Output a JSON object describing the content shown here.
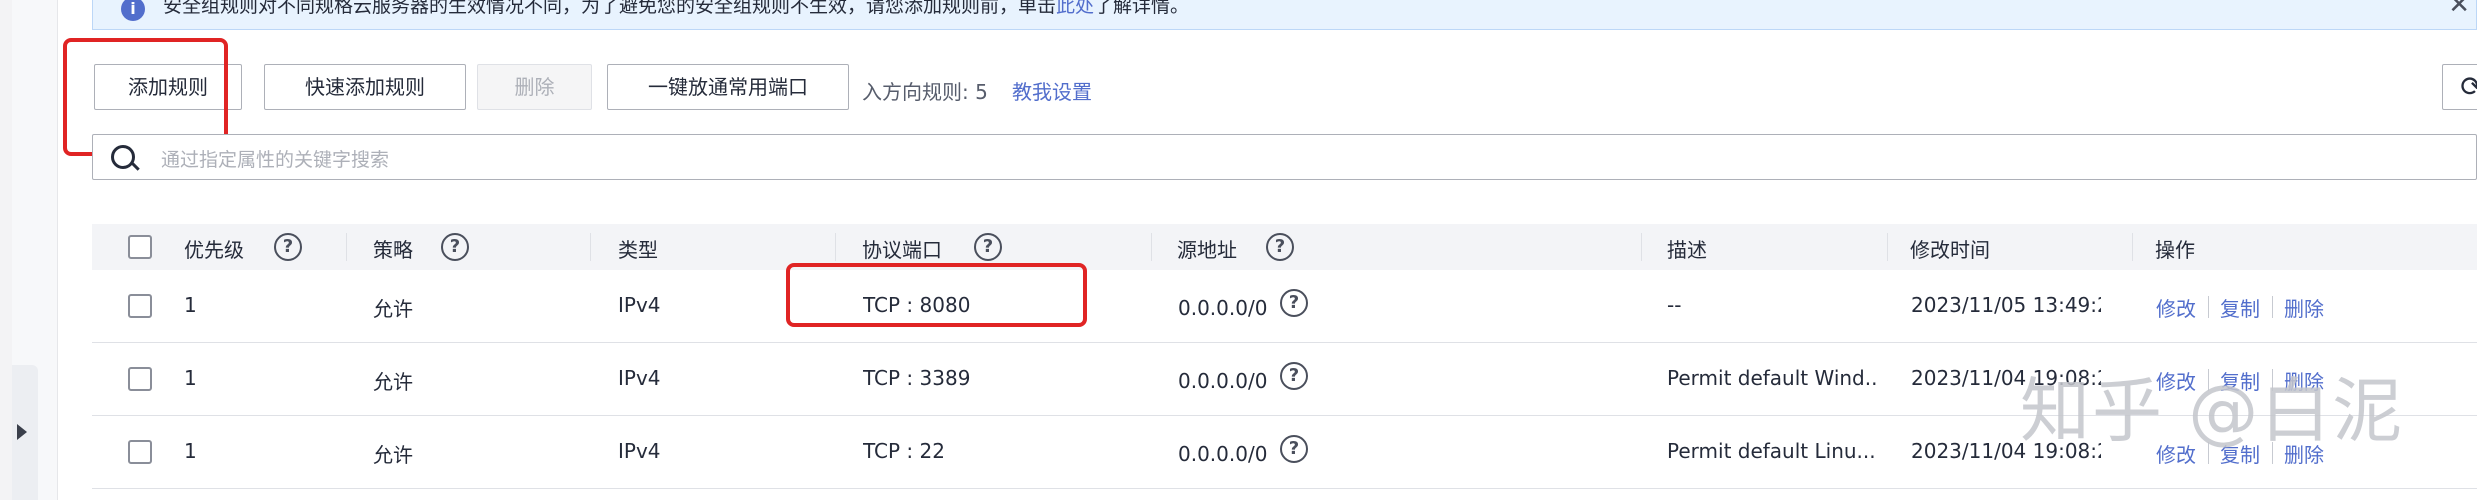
{
  "notice": {
    "text_before_link": "安全组规则对不同规格云服务器的生效情况不同，为了避免您的安全组规则不生效，请您添加规则前，单击",
    "link_text": "此处",
    "text_after_link": "了解详情。"
  },
  "toolbar": {
    "add_rule": "添加规则",
    "quick_add_rule": "快速添加规则",
    "delete": "删除",
    "one_click_open_ports": "一键放通常用端口",
    "inbound_rules_label": "入方向规则: 5",
    "teach_me_link": "教我设置"
  },
  "search": {
    "placeholder": "通过指定属性的关键字搜索"
  },
  "table": {
    "headers": {
      "priority": "优先级",
      "policy": "策略",
      "type": "类型",
      "protocol_port": "协议端口",
      "source": "源地址",
      "description": "描述",
      "modified_time": "修改时间",
      "actions": "操作"
    },
    "rows": [
      {
        "priority": "1",
        "policy": "允许",
        "type": "IPv4",
        "protocol_port": "TCP : 8080",
        "source": "0.0.0.0/0",
        "description": "--",
        "modified_time": "2023/11/05 13:49:2..."
      },
      {
        "priority": "1",
        "policy": "允许",
        "type": "IPv4",
        "protocol_port": "TCP : 3389",
        "source": "0.0.0.0/0",
        "description": "Permit default Wind...",
        "modified_time": "2023/11/04 19:08:2..."
      },
      {
        "priority": "1",
        "policy": "允许",
        "type": "IPv4",
        "protocol_port": "TCP : 22",
        "source": "0.0.0.0/0",
        "description": "Permit default Linu...",
        "modified_time": "2023/11/04 19:08:2..."
      }
    ],
    "action_labels": {
      "modify": "修改",
      "copy": "复制",
      "delete": "删除"
    }
  },
  "watermark": "知乎 @白泥",
  "colors": {
    "link_blue": "#526ecc",
    "highlight_red": "#e02424",
    "notice_bg": "#e8f3fe",
    "header_bg": "#f3f4f7"
  }
}
